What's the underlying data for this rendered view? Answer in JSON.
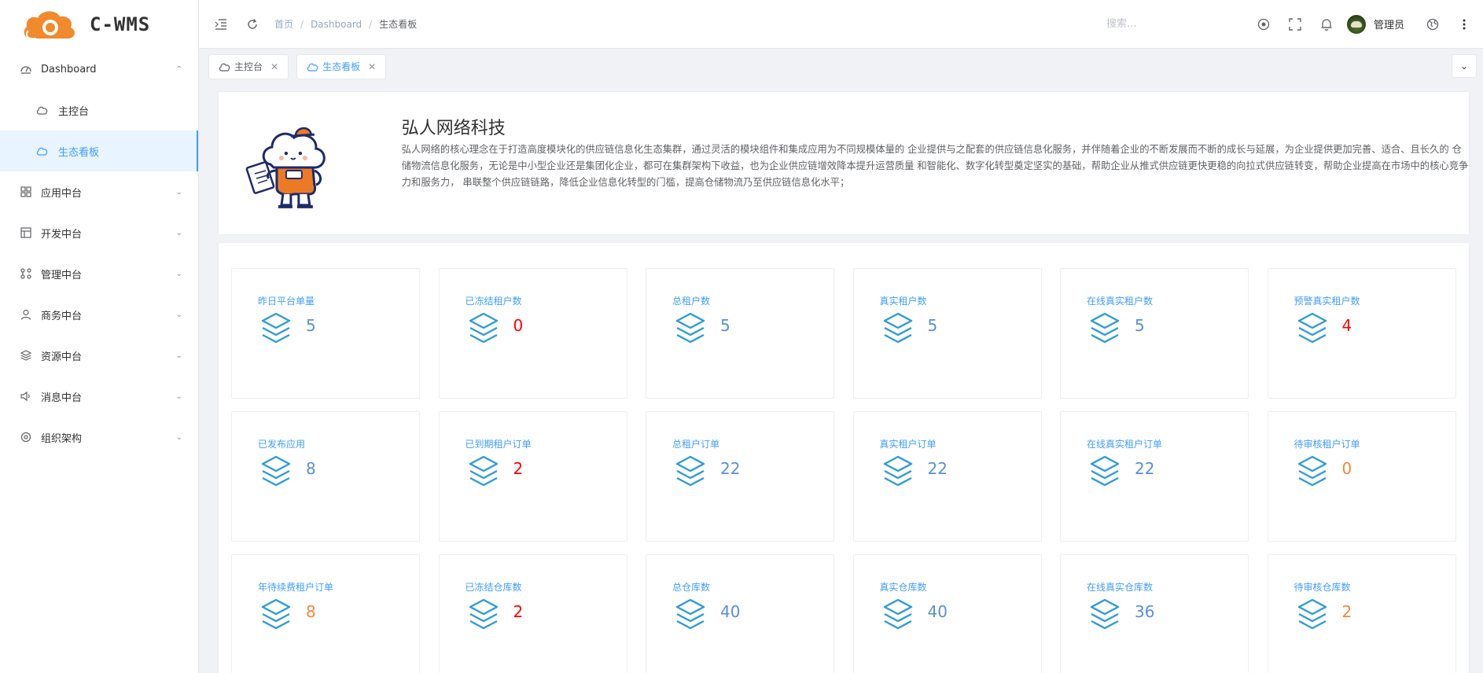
{
  "app": {
    "logo_text": "C-WMS"
  },
  "sidebar": {
    "items": [
      {
        "label": "Dashboard",
        "icon": "dashboard-icon",
        "expanded": true
      },
      {
        "label": "应用中台",
        "icon": "grid-icon"
      },
      {
        "label": "开发中台",
        "icon": "layout-icon"
      },
      {
        "label": "管理中台",
        "icon": "nodes-icon"
      },
      {
        "label": "商务中台",
        "icon": "user-icon"
      },
      {
        "label": "资源中台",
        "icon": "layers-icon"
      },
      {
        "label": "消息中台",
        "icon": "sound-icon"
      },
      {
        "label": "组织架构",
        "icon": "settings-icon"
      }
    ],
    "sub_items": [
      {
        "label": "主控台",
        "icon": "cloud-icon",
        "active": false
      },
      {
        "label": "生态看板",
        "icon": "cloud-icon",
        "active": true
      }
    ]
  },
  "header": {
    "breadcrumb": [
      "首页",
      "Dashboard",
      "生态看板"
    ],
    "search_placeholder": "搜索...",
    "user_name": "管理员"
  },
  "tabs": [
    {
      "label": "主控台",
      "active": false
    },
    {
      "label": "生态看板",
      "active": true
    }
  ],
  "intro": {
    "title": "弘人网络科技",
    "description": "弘人网络的核心理念在于打造高度模块化的供应链信息化生态集群，通过灵活的模块组件和集成应用为不同规模体量的 企业提供与之配套的供应链信息化服务，并伴随着企业的不断发展而不断的成长与延展，为企业提供更加完善、适合、且长久的 仓储物流信息化服务，无论是中小型企业还是集团化企业，都可在集群架构下收益，也为企业供应链增效降本提升运营质量 和智能化、数字化转型奠定坚实的基础，帮助企业从推式供应链更快更稳的向拉式供应链转变，帮助企业提高在市场中的核心竞争力和服务力， 串联整个供应链链路，降低企业信息化转型的门槛，提高仓储物流乃至供应链信息化水平；"
  },
  "colors": {
    "accent": "#409eff",
    "danger": "#ff0000",
    "warning": "#f0883a",
    "value_default": "#5b8fd4"
  },
  "stats": [
    {
      "title": "昨日平台单量",
      "value": "5",
      "color": "#5b8fd4"
    },
    {
      "title": "已冻结租户数",
      "value": "0",
      "color": "#ff0000"
    },
    {
      "title": "总租户数",
      "value": "5",
      "color": "#5b8fd4"
    },
    {
      "title": "真实租户数",
      "value": "5",
      "color": "#5b8fd4"
    },
    {
      "title": "在线真实租户数",
      "value": "5",
      "color": "#5b8fd4"
    },
    {
      "title": "预警真实租户数",
      "value": "4",
      "color": "#ff0000"
    },
    {
      "title": "已发布应用",
      "value": "8",
      "color": "#5b8fd4"
    },
    {
      "title": "已到期租户订单",
      "value": "2",
      "color": "#ff0000"
    },
    {
      "title": "总租户订单",
      "value": "22",
      "color": "#5b8fd4"
    },
    {
      "title": "真实租户订单",
      "value": "22",
      "color": "#5b8fd4"
    },
    {
      "title": "在线真实租户订单",
      "value": "22",
      "color": "#5b8fd4"
    },
    {
      "title": "待审核租户订单",
      "value": "0",
      "color": "#f0883a"
    },
    {
      "title": "年待续费租户订单",
      "value": "8",
      "color": "#f0883a"
    },
    {
      "title": "已冻结仓库数",
      "value": "2",
      "color": "#ff0000"
    },
    {
      "title": "总仓库数",
      "value": "40",
      "color": "#5b8fd4"
    },
    {
      "title": "真实仓库数",
      "value": "40",
      "color": "#5b8fd4"
    },
    {
      "title": "在线真实仓库数",
      "value": "36",
      "color": "#5b8fd4"
    },
    {
      "title": "待审核仓库数",
      "value": "2",
      "color": "#f0883a"
    }
  ]
}
